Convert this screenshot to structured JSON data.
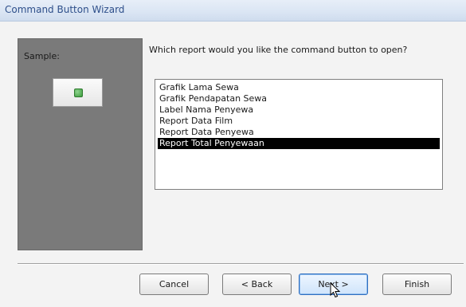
{
  "window": {
    "title": "Command Button Wizard"
  },
  "sample": {
    "label": "Sample:",
    "icon": "green-square-icon"
  },
  "prompt": {
    "question": "Which report would you like the command button to open?"
  },
  "reports": {
    "items": [
      "Grafik Lama Sewa",
      "Grafik Pendapatan Sewa",
      "Label Nama Penyewa",
      "Report Data Film",
      "Report Data Penyewa",
      "Report Total Penyewaan"
    ],
    "selected": "Report Total Penyewaan"
  },
  "buttons": {
    "cancel": "Cancel",
    "back": "< Back",
    "next": "Next >",
    "finish": "Finish"
  },
  "colors": {
    "title_text": "#2e4f8a",
    "selection_bg": "#000000",
    "sample_panel": "#7a7a7a",
    "sample_icon": "#3a9a3a"
  }
}
